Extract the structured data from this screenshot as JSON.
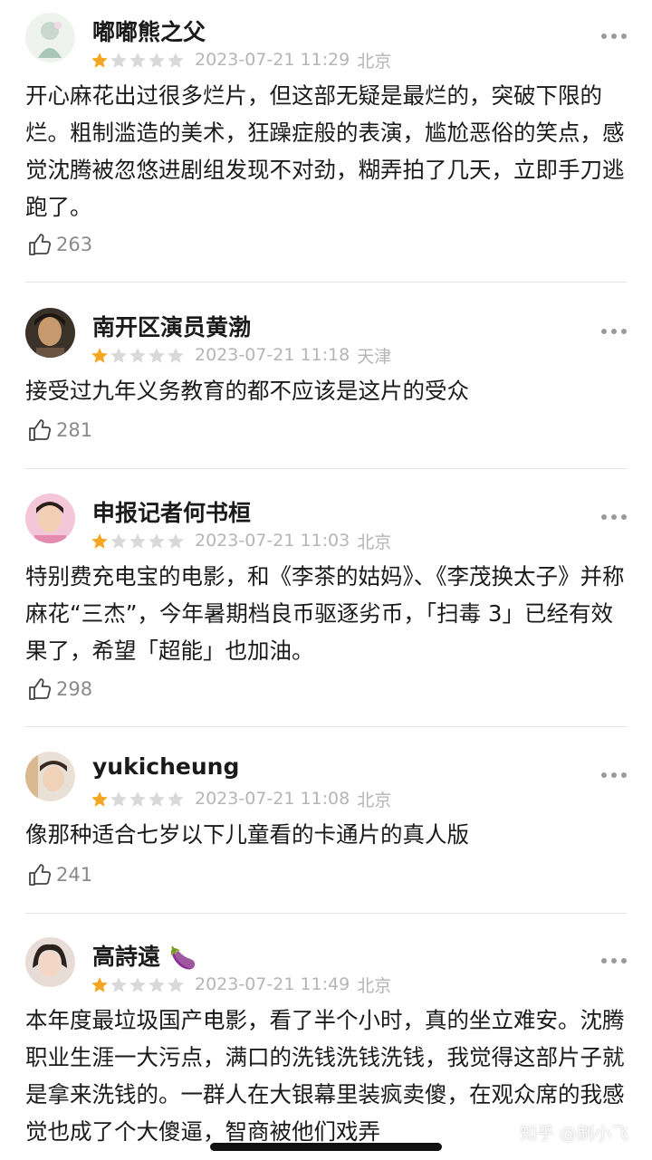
{
  "reviews": [
    {
      "username": "嘟嘟熊之父",
      "rating": 1,
      "max_rating": 5,
      "date": "2023-07-21 11:29",
      "location": "北京",
      "text": "开心麻花出过很多烂片，但这部无疑是最烂的，突破下限的烂。粗制滥造的美术，狂躁症般的表演，尴尬恶俗的笑点，感觉沈腾被忽悠进剧组发现不对劲，糊弄拍了几天，立即手刀逃跑了。",
      "likes": "263"
    },
    {
      "username": "南开区演员黄渤",
      "rating": 1,
      "max_rating": 5,
      "date": "2023-07-21 11:18",
      "location": "天津",
      "text": "接受过九年义务教育的都不应该是这片的受众",
      "likes": "281"
    },
    {
      "username": "申报记者何书桓",
      "rating": 1,
      "max_rating": 5,
      "date": "2023-07-21 11:03",
      "location": "北京",
      "text": "特别费充电宝的电影，和《李茶的姑妈》、《李茂换太子》并称麻花“三杰”，今年暑期档良币驱逐劣币，「扫毒 3」已经有效果了，希望「超能」也加油。",
      "likes": "298"
    },
    {
      "username": "yukicheung",
      "rating": 1,
      "max_rating": 5,
      "date": "2023-07-21 11:08",
      "location": "北京",
      "text": "像那种适合七岁以下儿童看的卡通片的真人版",
      "likes": "241"
    },
    {
      "username": "高詩遠",
      "badge_emoji": "🍆",
      "rating": 1,
      "max_rating": 5,
      "date": "2023-07-21 11:49",
      "location": "北京",
      "text": "本年度最垃圾国产电影，看了半个小时，真的坐立难安。沈腾职业生涯一大污点，满口的洗钱洗钱洗钱，我觉得这部片子就是拿来洗钱的。一群人在大银幕里装疯卖傻，在观众席的我感觉也成了个大傻逼，智商被他们戏弄"
    }
  ],
  "watermark": "知乎 @刷小飞",
  "colors": {
    "star_filled": "#f5a623",
    "star_empty": "#d9d9d9",
    "meta_text": "#b5b5b5",
    "like_text": "#8a8a8a"
  },
  "icons": {
    "more": "more-horizontal-icon",
    "like": "thumbs-up-icon",
    "star": "star-icon"
  }
}
